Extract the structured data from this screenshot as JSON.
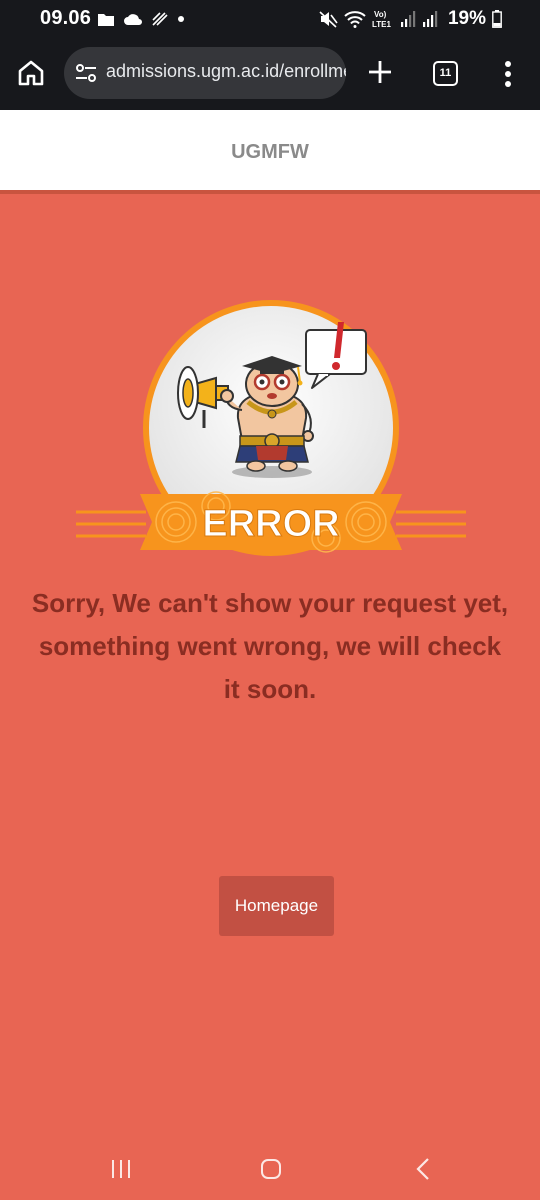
{
  "status_bar": {
    "time": "09.06",
    "battery": "19%"
  },
  "browser": {
    "url": "admissions.ugm.ac.id/enrollment",
    "tab_count": "11"
  },
  "site": {
    "title": "UGMFW"
  },
  "error": {
    "badge_text": "ERROR",
    "message": "Sorry, We can't show your request yet, something went wrong, we will check it soon."
  },
  "actions": {
    "homepage_label": "Homepage"
  },
  "colors": {
    "page_background": "#e86553",
    "message_text": "#8a2d22",
    "button_background": "#c25043",
    "ribbon_orange": "#f7941d"
  }
}
